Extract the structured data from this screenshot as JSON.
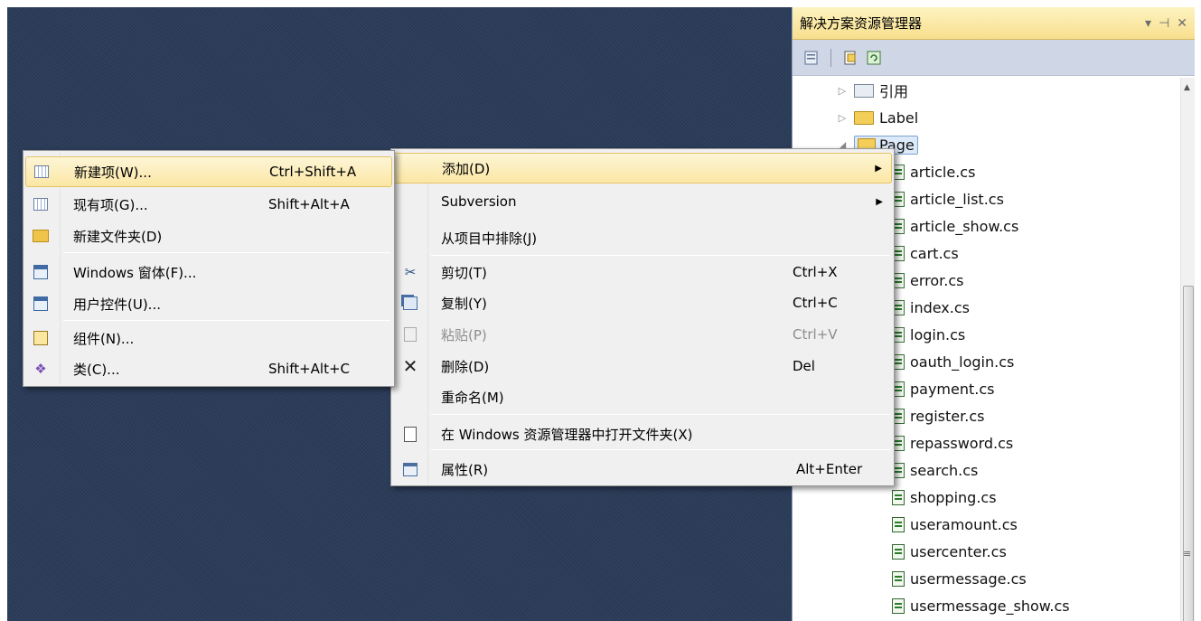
{
  "solution_explorer": {
    "title": "解决方案资源管理器",
    "title_buttons": [
      "▾",
      "⊣",
      "✕"
    ],
    "tree": [
      {
        "label": "引用",
        "kind": "references",
        "expander": "▷"
      },
      {
        "label": "Label",
        "kind": "folder",
        "expander": "▷"
      },
      {
        "label": "Page",
        "kind": "folder-open",
        "expander": "◢"
      },
      {
        "label": "article.cs",
        "kind": "file"
      },
      {
        "label": "article_list.cs",
        "kind": "file"
      },
      {
        "label": "article_show.cs",
        "kind": "file"
      },
      {
        "label": "cart.cs",
        "kind": "file"
      },
      {
        "label": "error.cs",
        "kind": "file"
      },
      {
        "label": "index.cs",
        "kind": "file"
      },
      {
        "label": "login.cs",
        "kind": "file"
      },
      {
        "label": "oauth_login.cs",
        "kind": "file"
      },
      {
        "label": "payment.cs",
        "kind": "file"
      },
      {
        "label": "register.cs",
        "kind": "file"
      },
      {
        "label": "repassword.cs",
        "kind": "file"
      },
      {
        "label": "search.cs",
        "kind": "file"
      },
      {
        "label": "shopping.cs",
        "kind": "file"
      },
      {
        "label": "useramount.cs",
        "kind": "file"
      },
      {
        "label": "usercenter.cs",
        "kind": "file"
      },
      {
        "label": "usermessage.cs",
        "kind": "file"
      },
      {
        "label": "usermessage_show.cs",
        "kind": "file"
      }
    ]
  },
  "context_menu": {
    "items": [
      {
        "label": "添加(D)",
        "shortcut": "",
        "submenu": true,
        "highlighted": true,
        "icon": ""
      },
      {
        "label": "Subversion",
        "shortcut": "",
        "submenu": true,
        "icon": ""
      },
      {
        "label": "从项目中排除(J)",
        "shortcut": "",
        "icon": ""
      },
      {
        "label": "剪切(T)",
        "shortcut": "Ctrl+X",
        "icon": "scissors-icon"
      },
      {
        "label": "复制(Y)",
        "shortcut": "Ctrl+C",
        "icon": "copy-icon"
      },
      {
        "label": "粘贴(P)",
        "shortcut": "Ctrl+V",
        "icon": "paste-icon",
        "disabled": true
      },
      {
        "label": "删除(D)",
        "shortcut": "Del",
        "icon": "delete-icon"
      },
      {
        "label": "重命名(M)",
        "shortcut": "",
        "icon": ""
      },
      {
        "label": "在 Windows 资源管理器中打开文件夹(X)",
        "shortcut": "",
        "icon": "open-folder-icon"
      },
      {
        "label": "属性(R)",
        "shortcut": "Alt+Enter",
        "icon": "properties-icon"
      }
    ]
  },
  "add_submenu": {
    "items": [
      {
        "label": "新建项(W)...",
        "shortcut": "Ctrl+Shift+A",
        "highlighted": true,
        "icon": "new-item-icon"
      },
      {
        "label": "现有项(G)...",
        "shortcut": "Shift+Alt+A",
        "icon": "existing-item-icon"
      },
      {
        "label": "新建文件夹(D)",
        "shortcut": "",
        "icon": "new-folder-icon"
      },
      {
        "label": "Windows 窗体(F)...",
        "shortcut": "",
        "icon": "windows-form-icon"
      },
      {
        "label": "用户控件(U)...",
        "shortcut": "",
        "icon": "user-control-icon"
      },
      {
        "label": "组件(N)...",
        "shortcut": "",
        "icon": "component-icon"
      },
      {
        "label": "类(C)...",
        "shortcut": "Shift+Alt+C",
        "icon": "class-icon"
      }
    ]
  },
  "colors": {
    "ide_background": "#2b3c59",
    "menu_highlight": "#fbe7a4",
    "panel_title": "#f8df8e"
  }
}
